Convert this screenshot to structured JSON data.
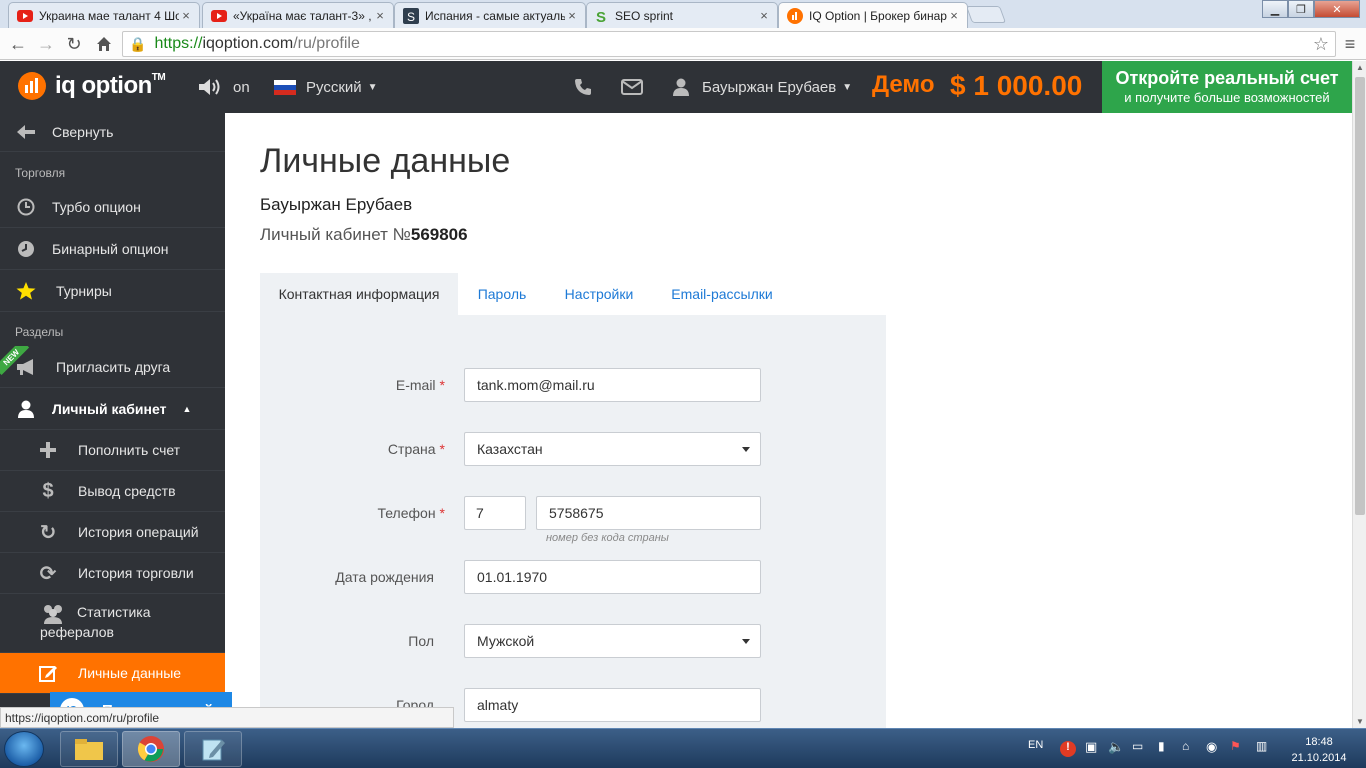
{
  "browser": {
    "tabs": [
      {
        "label": "Украина мае талант 4 Шо",
        "icon": "youtube-icon"
      },
      {
        "label": "«Україна має талант-3» ,",
        "icon": "youtube-icon"
      },
      {
        "label": "Испания - самые актуаль",
        "icon": "site-icon"
      },
      {
        "label": "SEO sprint",
        "icon": "seosprint-icon"
      },
      {
        "label": "IQ Option | Брокер бинар",
        "icon": "iqoption-icon",
        "active": true
      }
    ],
    "url_scheme": "https://",
    "url_host": "iqoption.com",
    "url_path": "/ru/profile",
    "status_url": "https://iqoption.com/ru/profile"
  },
  "header": {
    "logo_text": "iq option",
    "logo_tm": "TM",
    "sound_label": "on",
    "language": "Русский",
    "user_name": "Бауыржан Ерубаев",
    "demo_label": "Демо",
    "balance": "$ 1 000.00",
    "real_account_title": "Откройте реальный счет",
    "real_account_subtitle": "и получите больше возможностей",
    "accent_color": "#ff7200",
    "cta_color": "#2ea54b"
  },
  "sidebar": {
    "collapse": "Свернуть",
    "section_trading": "Торговля",
    "turbo": "Турбо опцион",
    "binary": "Бинарный опцион",
    "tournaments": "Турниры",
    "section_sections": "Разделы",
    "invite": "Пригласить друга",
    "new_badge": "NEW",
    "cabinet": "Личный кабинет",
    "deposit": "Пополнить счет",
    "withdraw": "Вывод средств",
    "ops_history": "История операций",
    "trade_history": "История торговли",
    "referral_stats_1": "Статистика",
    "referral_stats_2": "рефералов",
    "personal_data": "Личные данные",
    "help_online": "Помощь онлайн",
    "help_badge": "IQ"
  },
  "page": {
    "title": "Личные данные",
    "user_name": "Бауыржан Ерубаев",
    "cabinet_prefix": "Личный кабинет №",
    "cabinet_number": "569806",
    "tabs": [
      "Контактная информация",
      "Пароль",
      "Настройки",
      "Email-рассылки"
    ]
  },
  "form": {
    "email_label": "E-mail",
    "email_value": "tank.mom@mail.ru",
    "country_label": "Страна",
    "country_value": "Казахстан",
    "phone_label": "Телефон",
    "phone_code": "7",
    "phone_number": "5758675",
    "phone_hint": "номер без кода страны",
    "birth_label": "Дата рождения",
    "birth_value": "01.01.1970",
    "gender_label": "Пол",
    "gender_value": "Мужской",
    "city_label": "Город",
    "city_value": "almaty",
    "required_mark": "*"
  },
  "taskbar": {
    "lang": "EN",
    "time": "18:48",
    "date": "21.10.2014"
  }
}
